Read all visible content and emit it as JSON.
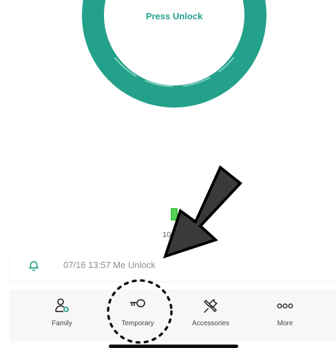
{
  "unlock": {
    "label": "Press Unlock"
  },
  "battery": {
    "text": "10"
  },
  "log": {
    "text": "07/16 13:57 Me Unlock"
  },
  "nav": {
    "items": [
      {
        "label": "Family",
        "icon": "family-icon"
      },
      {
        "label": "Temporary",
        "icon": "key-icon"
      },
      {
        "label": "Accessories",
        "icon": "tools-icon"
      },
      {
        "label": "More",
        "icon": "more-dots-icon"
      }
    ]
  },
  "colors": {
    "accent": "#24a18b",
    "battery": "#3cbf3c",
    "arrow": "#3a3a3a"
  }
}
